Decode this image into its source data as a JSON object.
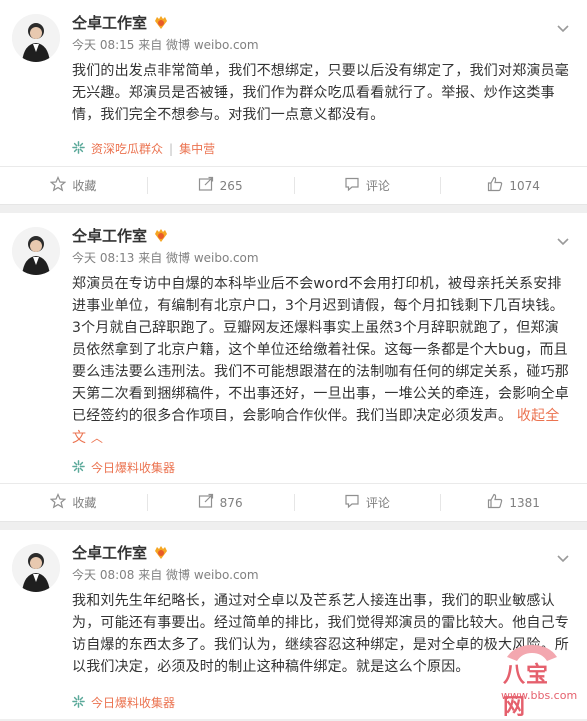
{
  "colors": {
    "accent": "#eb7350",
    "meta": "#808080",
    "text": "#333333"
  },
  "posts": [
    {
      "author": "仝卓工作室",
      "time": "今天 08:15",
      "via": "来自 微博 weibo.com",
      "text": "我们的出发点非常简单，我们不想绑定，只要以后没有绑定了，我们对郑演员毫无兴趣。郑演员是否被锤，我们作为群众吃瓜看看就行了。举报、炒作这类事情，我们完全不想参与。对我们一点意义都没有。",
      "source": "资深吃瓜群众",
      "source_extra": "集中营",
      "actions": {
        "fav": "收藏",
        "repost": "265",
        "comment": "评论",
        "like": "1074"
      }
    },
    {
      "author": "仝卓工作室",
      "time": "今天 08:13",
      "via": "来自 微博 weibo.com",
      "text": "郑演员在专访中自爆的本科毕业后不会word不会用打印机，被母亲托关系安排进事业单位，有编制有北京户口，3个月迟到请假，每个月扣钱剩下几百块钱。3个月就自己辞职跑了。豆瓣网友还爆料事实上虽然3个月辞职就跑了，但郑演员依然拿到了北京户籍，这个单位还给缴着社保。这每一条都是个大bug，而且要么违法要么违刑法。我们不可能想跟潜在的法制咖有任何的绑定关系，碰巧那天第二次看到捆绑稿件，不出事还好，一旦出事，一堆公关的牵连，会影响仝卓已经签约的很多合作项目，会影响合作伙伴。我们当即决定必须发声。",
      "collapse": "收起全文",
      "source": "今日爆料收集器",
      "actions": {
        "fav": "收藏",
        "repost": "876",
        "comment": "评论",
        "like": "1381"
      }
    },
    {
      "author": "仝卓工作室",
      "time": "今天 08:08",
      "via": "来自 微博 weibo.com",
      "text": "我和刘先生年纪略长，通过对仝卓以及芒系艺人接连出事，我们的职业敏感认为，可能还有事要出。经过简单的排比，我们觉得郑演员的雷比较大。他自己专访自爆的东西太多了。我们认为，继续容忍这种绑定，是对仝卓的极大风险。所以我们决定，必须及时的制止这种稿件绑定。就是这么个原因。",
      "source": "今日爆料收集器"
    }
  ],
  "watermark": {
    "text": "八宝网",
    "url": "www.bbs.com"
  }
}
